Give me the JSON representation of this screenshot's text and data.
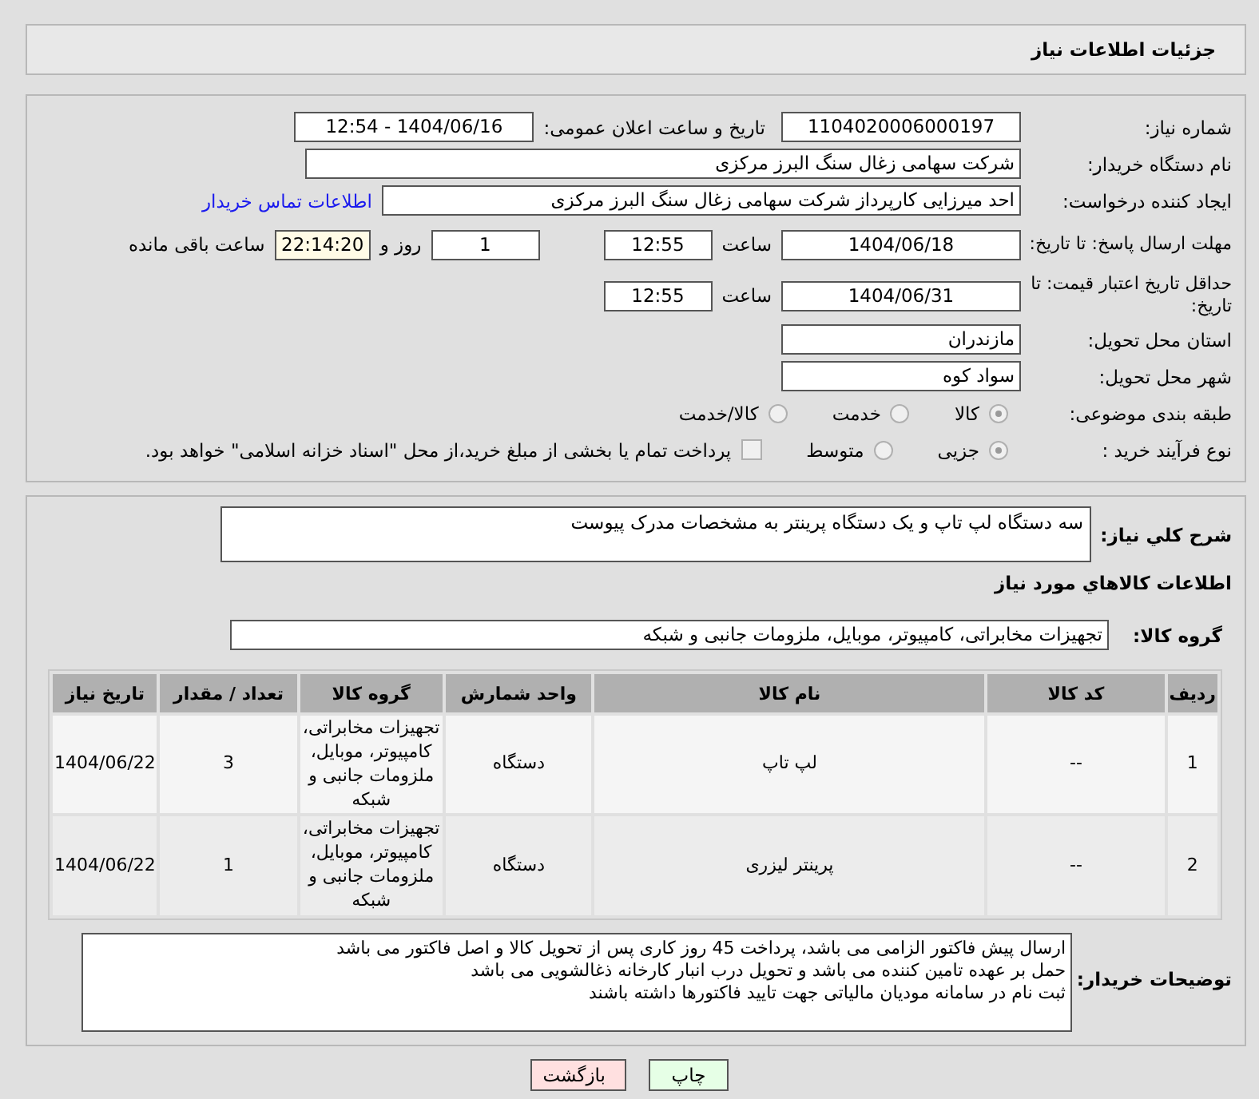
{
  "page_title": "جزئیات اطلاعات نیاز",
  "need_number": {
    "label": "شماره نیاز:",
    "value": "1104020006000197"
  },
  "announce": {
    "label": "تاریخ و ساعت اعلان عمومی:",
    "value": "1404/06/16 - 12:54"
  },
  "buyer_org": {
    "label": "نام دستگاه خریدار:",
    "value": "شرکت سهامی زغال سنگ البرز مرکزی"
  },
  "creator": {
    "label": "ایجاد کننده درخواست:",
    "value": "احد میرزایی کارپرداز شرکت سهامی زغال سنگ البرز مرکزی",
    "link": "اطلاعات تماس خریدار"
  },
  "reply_deadline": {
    "label": "مهلت ارسال پاسخ: تا تاریخ:",
    "date": "1404/06/18",
    "time_label": "ساعت",
    "time": "12:55",
    "days": "1",
    "days_label": "روز و",
    "remaining": "22:14:20",
    "remaining_label": "ساعت باقی مانده"
  },
  "price_validity": {
    "label": "حداقل تاریخ اعتبار قیمت: تا تاریخ:",
    "date": "1404/06/31",
    "time_label": "ساعت",
    "time": "12:55"
  },
  "province": {
    "label": "استان محل تحویل:",
    "value": "مازندران"
  },
  "city": {
    "label": "شهر محل تحویل:",
    "value": "سواد کوه"
  },
  "category": {
    "label": "طبقه بندی موضوعی:",
    "options": [
      {
        "label": "کالا",
        "selected": true
      },
      {
        "label": "خدمت",
        "selected": false
      },
      {
        "label": "کالا/خدمت",
        "selected": false
      }
    ]
  },
  "process": {
    "label": "نوع فرآیند خرید :",
    "options": [
      {
        "label": "جزیی",
        "selected": true
      },
      {
        "label": "متوسط",
        "selected": false
      }
    ],
    "payment": {
      "label": "پرداخت تمام یا بخشی از مبلغ خرید،از محل \"اسناد خزانه اسلامی\" خواهد بود.",
      "checked": false
    }
  },
  "description": {
    "label": "شرح کلي نياز:",
    "value": "سه دستگاه لپ تاپ  و یک دستگاه پرینتر به مشخصات مدرک پیوست"
  },
  "goods_title": "اطلاعات کالاهاي مورد نياز",
  "goods_group": {
    "label": "گروه کالا:",
    "value": "تجهیزات مخابراتی، کامپیوتر، موبایل، ملزومات جانبی و شبکه"
  },
  "table": {
    "columns": [
      "ردیف",
      "کد کالا",
      "نام کالا",
      "واحد شمارش",
      "گروه کالا",
      "تعداد / مقدار",
      "تاریخ نیاز"
    ],
    "rows": [
      [
        "1",
        "--",
        "لپ تاپ",
        "دستگاه",
        "تجهیزات مخابراتی، کامپیوتر، موبایل، ملزومات جانبی و شبکه",
        "3",
        "1404/06/22"
      ],
      [
        "2",
        "--",
        "پرینتر لیزری",
        "دستگاه",
        "تجهیزات مخابراتی، کامپیوتر، موبایل، ملزومات جانبی و شبکه",
        "1",
        "1404/06/22"
      ]
    ]
  },
  "buyer_notes": {
    "label": "توضیحات خریدار:",
    "lines": [
      "ارسال پیش فاکتور الزامی می باشد، پرداخت  45 روز کاری پس از تحویل کالا و اصل فاکتور می باشد",
      "حمل بر عهده تامین کننده می باشد و تحویل درب انبار کارخانه ذغالشویی می باشد",
      "ثبت نام در سامانه مودیان مالیاتی جهت تایید فاکتورها داشته باشند"
    ]
  },
  "buttons": [
    {
      "label": "چاپ",
      "kind": "print"
    },
    {
      "label": "بازگشت",
      "kind": "back"
    }
  ]
}
